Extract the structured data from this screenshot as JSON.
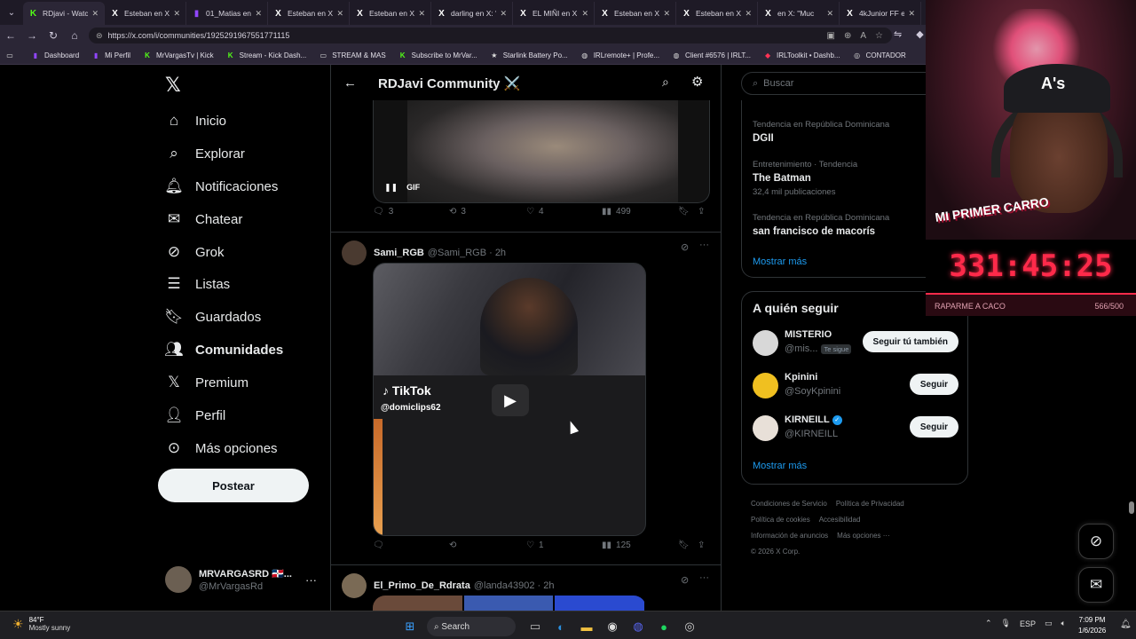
{
  "browser": {
    "tabs": [
      {
        "title": "RDjavi - Watch",
        "icon": "kick-icon",
        "color": "#53fc18"
      },
      {
        "title": "Esteban en X: \"",
        "icon": "x-icon",
        "color": "#ffffff"
      },
      {
        "title": "01_Matias en",
        "icon": "twitch-icon",
        "color": "#9146ff"
      },
      {
        "title": "Esteban en X: \"",
        "icon": "x-icon",
        "color": "#ffffff"
      },
      {
        "title": "Esteban en X: \"",
        "icon": "x-icon",
        "color": "#ffffff"
      },
      {
        "title": "darling en X: \"L",
        "icon": "x-icon",
        "color": "#ffffff"
      },
      {
        "title": "EL MIÑI en X: \"",
        "icon": "x-icon",
        "color": "#ffffff"
      },
      {
        "title": "Esteban en X: \"",
        "icon": "x-icon",
        "color": "#ffffff"
      },
      {
        "title": "Esteban en X: \"",
        "icon": "x-icon",
        "color": "#ffffff"
      },
      {
        "title": "en X: \"Muc",
        "icon": "x-icon",
        "color": "#ffffff"
      },
      {
        "title": "4kJunior FF en",
        "icon": "x-icon",
        "color": "#ffffff"
      }
    ],
    "url": "https://x.com/i/communities/1925291967551771115",
    "bookmarks": [
      {
        "label": "Dashboard",
        "icon": "twitch-icon",
        "color": "#9146ff"
      },
      {
        "label": "Mi Perfil",
        "icon": "twitch-icon",
        "color": "#9146ff"
      },
      {
        "label": "MrVargasTv | Kick",
        "icon": "kick-icon",
        "color": "#53fc18"
      },
      {
        "label": "Stream - Kick Dash...",
        "icon": "kick-icon",
        "color": "#53fc18"
      },
      {
        "label": "STREAM & MAS",
        "icon": "folder-icon",
        "color": "#dddddd"
      },
      {
        "label": "Subscribe to MrVar...",
        "icon": "kick-icon",
        "color": "#53fc18"
      },
      {
        "label": "Starlink Battery Po...",
        "icon": "starlink-icon",
        "color": "#dddddd"
      },
      {
        "label": "IRLremote+ | Profe...",
        "icon": "globe-icon",
        "color": "#dddddd"
      },
      {
        "label": "Client #6576 | IRLT...",
        "icon": "globe-icon",
        "color": "#dddddd"
      },
      {
        "label": "IRLToolkit • Dashb...",
        "icon": "irltoolkit-icon",
        "color": "#ff3355"
      },
      {
        "label": "CONTADOR",
        "icon": "contador-icon",
        "color": "#dddddd"
      }
    ]
  },
  "nav": {
    "items": [
      {
        "label": "Inicio",
        "icon": "home-icon"
      },
      {
        "label": "Explorar",
        "icon": "search-icon"
      },
      {
        "label": "Notificaciones",
        "icon": "bell-icon"
      },
      {
        "label": "Chatear",
        "icon": "mail-icon"
      },
      {
        "label": "Grok",
        "icon": "grok-icon"
      },
      {
        "label": "Listas",
        "icon": "list-icon"
      },
      {
        "label": "Guardados",
        "icon": "bookmark-icon"
      },
      {
        "label": "Comunidades",
        "icon": "communities-icon"
      },
      {
        "label": "Premium",
        "icon": "x-icon"
      },
      {
        "label": "Perfil",
        "icon": "person-icon"
      },
      {
        "label": "Más opciones",
        "icon": "more-circle-icon"
      }
    ],
    "post_label": "Postear",
    "account": {
      "name": "MRVARGASRD 🇩🇴...",
      "handle": "@MrVargasRd"
    }
  },
  "community": {
    "title": "RDJavi Community ⚔️",
    "gif_label": "GIF",
    "post1_stats": {
      "replies": "3",
      "reposts": "3",
      "likes": "4",
      "views": "499"
    },
    "post2": {
      "name": "Sami_RGB",
      "meta": "@Sami_RGB · 2h",
      "tiktok_logo": "TikTok",
      "tiktok_user": "@domiclips62",
      "stats": {
        "replies": "",
        "reposts": "",
        "likes": "1",
        "views": "125"
      }
    },
    "post3": {
      "name": "El_Primo_De_Rdrata",
      "meta": "@landa43902 · 2h"
    }
  },
  "sidebar": {
    "search_placeholder": "Buscar",
    "trends": [
      {
        "context": "Tendencia en República Dominicana",
        "name": "DGII",
        "count": ""
      },
      {
        "context": "Entretenimiento · Tendencia",
        "name": "The Batman",
        "count": "32,4 mil publicaciones"
      },
      {
        "context": "Tendencia en República Dominicana",
        "name": "san francisco de macorís",
        "count": ""
      }
    ],
    "show_more": "Mostrar más",
    "who_to_follow_title": "A quién seguir",
    "who_to_follow": [
      {
        "name": "MISTERIO",
        "handle": "@mis...",
        "badge": "Te sigue",
        "button": "Seguir tú también"
      },
      {
        "name": "Kpinini",
        "handle": "@SoyKpinini",
        "badge": "",
        "button": "Seguir"
      },
      {
        "name": "KIRNEILL",
        "handle": "@KIRNEILL",
        "badge": "",
        "button": "Seguir"
      }
    ],
    "show_more_2": "Mostrar más",
    "footer": {
      "links": [
        "Condiciones de Servicio",
        "Política de Privacidad",
        "Política de cookies",
        "Accesibilidad",
        "Información de anuncios",
        "Más opciones ···"
      ],
      "copyright": "© 2026 X Corp."
    }
  },
  "overlay": {
    "sign": "MI PRIMER CARRO",
    "cap_logo": "A's",
    "timer": "331:45:25",
    "timer_label": "RAPARME A CACO",
    "timer_count": "566/500"
  },
  "taskbar": {
    "weather_temp": "84°F",
    "weather_desc": "Mostly sunny",
    "search_label": "Search",
    "lang": "ESP",
    "time": "7:09 PM",
    "date": "1/6/2026"
  }
}
